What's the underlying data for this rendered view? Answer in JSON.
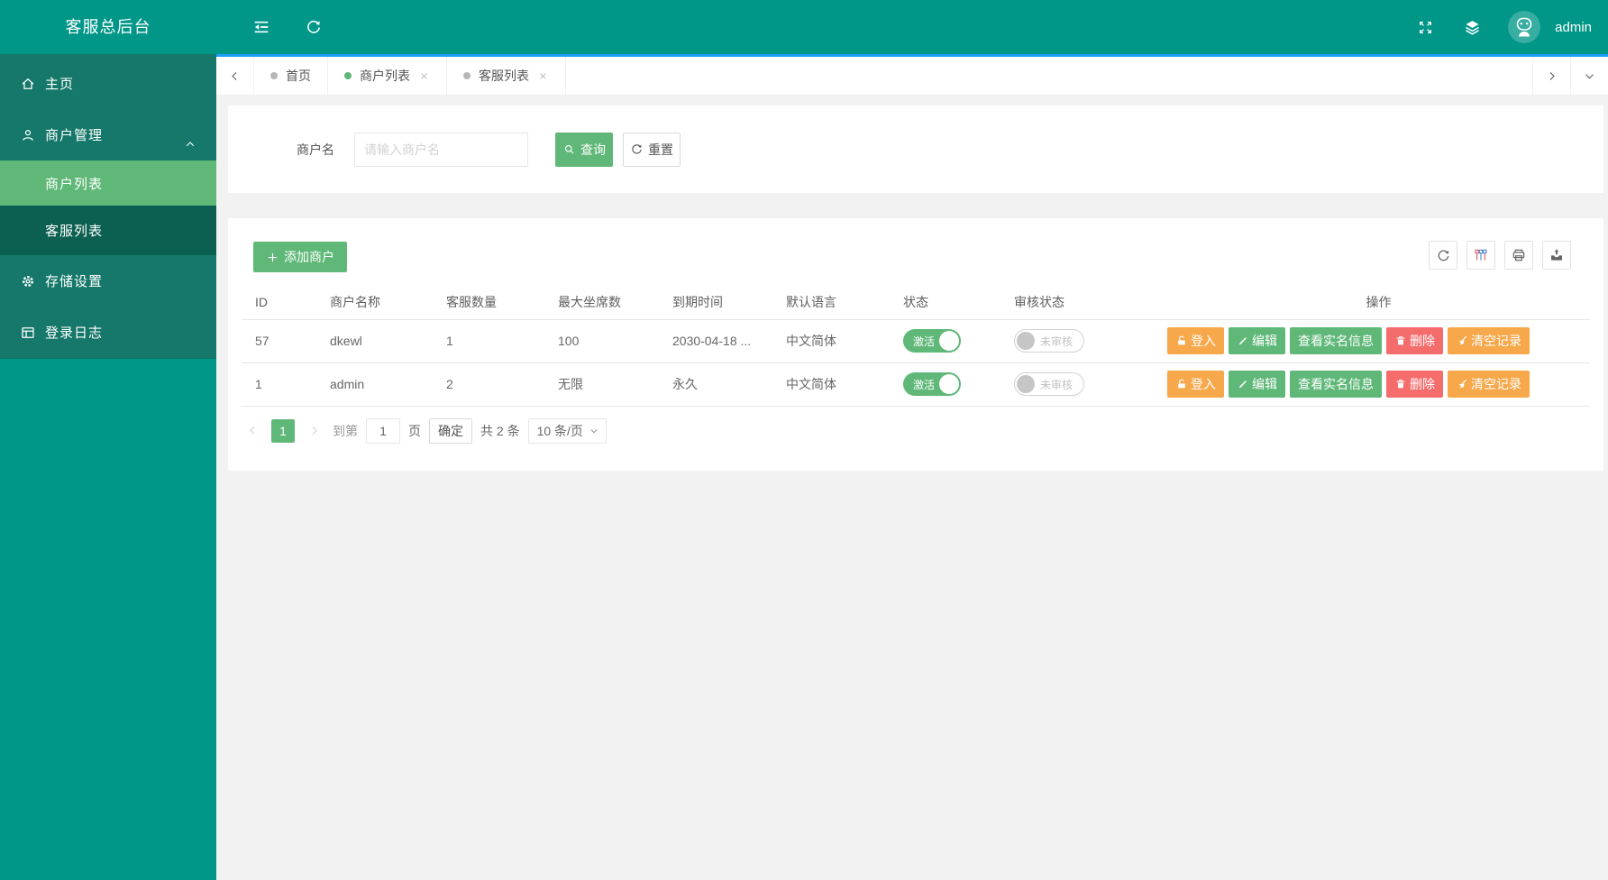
{
  "app": {
    "title": "客服总后台",
    "user": "admin"
  },
  "colors": {
    "primary_teal": "#009688",
    "green": "#5FB878",
    "orange": "#F6A84A",
    "red": "#F56C6C",
    "accent_blue": "#1E9FFF"
  },
  "icons": [
    "collapse-icon",
    "refresh-icon",
    "fullscreen-icon",
    "layers-icon",
    "avatar",
    "home-icon",
    "user-icon",
    "gear-icon",
    "log-icon",
    "chevron-up-icon",
    "chevron-left-icon",
    "chevron-right-icon",
    "chevron-down-icon",
    "close-icon",
    "search-icon",
    "plus-icon",
    "unlock-icon",
    "pencil-icon",
    "trash-icon",
    "brush-icon",
    "columns-icon",
    "printer-icon",
    "export-icon"
  ],
  "sidebar": {
    "items": [
      {
        "label": "主页"
      },
      {
        "label": "商户管理",
        "expanded": true,
        "children": [
          {
            "label": "商户列表",
            "active": true
          },
          {
            "label": "客服列表",
            "active": false
          }
        ]
      },
      {
        "label": "存储设置"
      },
      {
        "label": "登录日志"
      }
    ]
  },
  "tabs": {
    "items": [
      {
        "label": "首页",
        "dot": "gray",
        "closable": false,
        "active": false
      },
      {
        "label": "商户列表",
        "dot": "green",
        "closable": true,
        "active": true
      },
      {
        "label": "客服列表",
        "dot": "gray",
        "closable": true,
        "active": false
      }
    ]
  },
  "search": {
    "label": "商户名",
    "placeholder": "请输入商户名",
    "value": "",
    "query": "查询",
    "reset": "重置"
  },
  "table": {
    "add_button": "添加商户",
    "columns": [
      "ID",
      "商户名称",
      "客服数量",
      "最大坐席数",
      "到期时间",
      "默认语言",
      "状态",
      "审核状态",
      "操作"
    ],
    "rows": [
      {
        "id": "57",
        "name": "dkewl",
        "agents": "1",
        "max_seats": "100",
        "expire": "2030-04-18 ...",
        "language": "中文简体",
        "status_label": "激活",
        "status_on": true,
        "audit_label": "未审核",
        "audit_on": false
      },
      {
        "id": "1",
        "name": "admin",
        "agents": "2",
        "max_seats": "无限",
        "expire": "永久",
        "language": "中文简体",
        "status_label": "激活",
        "status_on": true,
        "audit_label": "未审核",
        "audit_on": false
      }
    ],
    "actions": {
      "login": "登入",
      "edit": "编辑",
      "view_realname": "查看实名信息",
      "delete": "删除",
      "clear": "清空记录"
    }
  },
  "pagination": {
    "current": "1",
    "goto_prefix": "到第",
    "goto_value": "1",
    "goto_suffix": "页",
    "confirm": "确定",
    "total": "共 2 条",
    "page_size": "10 条/页"
  }
}
